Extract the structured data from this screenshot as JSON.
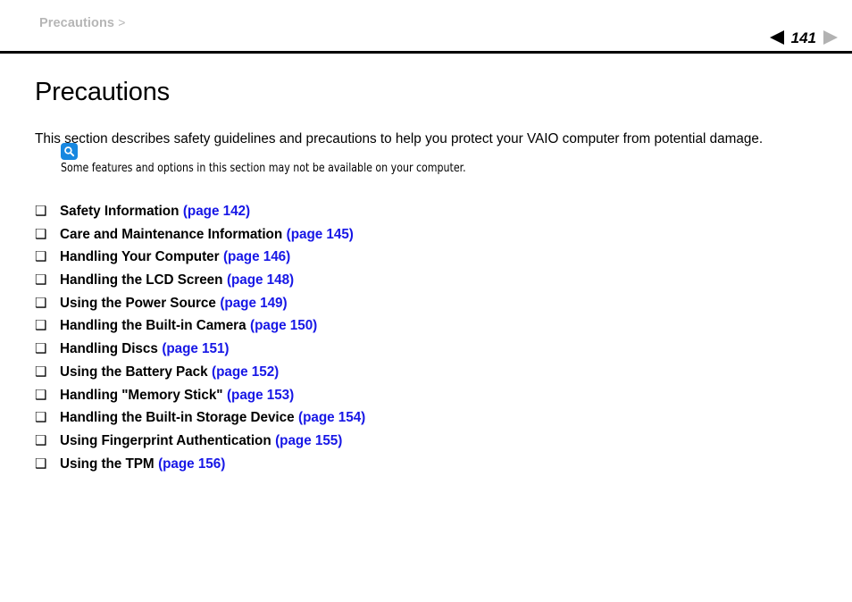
{
  "header": {
    "breadcrumb_text": "Precautions",
    "breadcrumb_separator": ">",
    "page_number": "141",
    "prev_arrow_icon": "triangle-left-icon",
    "next_arrow_icon": "triangle-right-icon",
    "prev_arrow_color": "#000000",
    "next_arrow_color": "#b2b2b2",
    "rule_color": "#000000"
  },
  "main": {
    "title": "Precautions",
    "intro": "This section describes safety guidelines and precautions to help you protect your VAIO computer from potential damage.",
    "note": {
      "icon": "magnifier-note-icon",
      "icon_color": "#1787e0",
      "text": "Some features and options in this section may not be available on your computer."
    },
    "link_color": "#1717e6",
    "bullet_glyph": "❑",
    "items": [
      {
        "label": "Safety Information",
        "page_link": "(page 142)"
      },
      {
        "label": "Care and Maintenance Information",
        "page_link": "(page 145)"
      },
      {
        "label": "Handling Your Computer",
        "page_link": "(page 146)"
      },
      {
        "label": "Handling the LCD Screen",
        "page_link": "(page 148)"
      },
      {
        "label": "Using the Power Source",
        "page_link": "(page 149)"
      },
      {
        "label": "Handling the Built-in Camera",
        "page_link": "(page 150)"
      },
      {
        "label": "Handling Discs",
        "page_link": "(page 151)"
      },
      {
        "label": "Using the Battery Pack",
        "page_link": "(page 152)"
      },
      {
        "label": "Handling \"Memory Stick\"",
        "page_link": "(page 153)"
      },
      {
        "label": "Handling the Built-in Storage Device",
        "page_link": "(page 154)"
      },
      {
        "label": "Using Fingerprint Authentication",
        "page_link": "(page 155)"
      },
      {
        "label": "Using the TPM",
        "page_link": "(page 156)"
      }
    ]
  }
}
